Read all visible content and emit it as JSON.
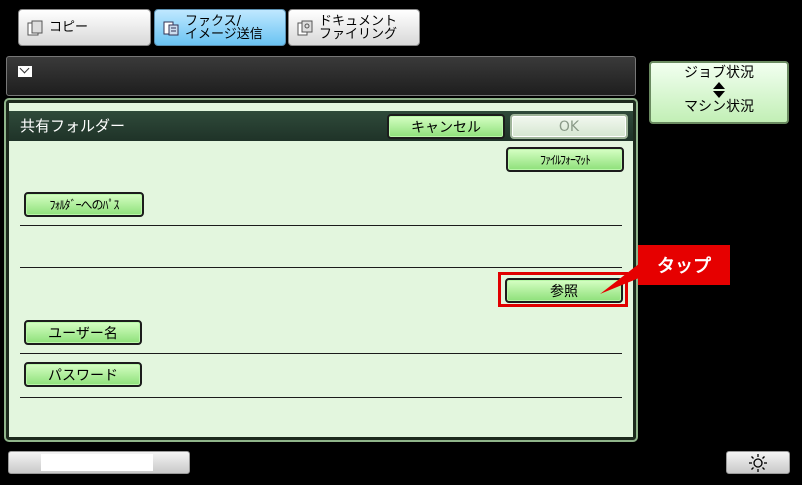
{
  "tabs": [
    {
      "label": "コピー",
      "icon": "copy-icon",
      "active": false
    },
    {
      "label": "ファクス/\nイメージ送信",
      "icon": "fax-icon",
      "active": true
    },
    {
      "label": "ドキュメント\nファイリング",
      "icon": "document-filing-icon",
      "active": false
    }
  ],
  "message_bar": {
    "icon": "envelope-icon"
  },
  "job_status": {
    "line1": "ジョブ状況",
    "line2": "マシン状況",
    "icon": "up-down-arrows-icon"
  },
  "panel": {
    "title": "共有フォルダー",
    "cancel_label": "キャンセル",
    "ok_label": "OK",
    "file_format_label": "ﾌｧｲﾙﾌｫｰﾏｯﾄ",
    "folder_path_label": "ﾌｫﾙﾀﾞｰへのﾊﾟｽ",
    "browse_label": "参照",
    "username_label": "ユーザー名",
    "password_label": "パスワード"
  },
  "annotation": {
    "callout": "タップ"
  },
  "bottom": {
    "settings_icon": "brightness-icon"
  },
  "colors": {
    "panel_bg": "#e3f6de",
    "button_green": "#8ee07a",
    "header_dark": "#2f4a3a",
    "highlight_red": "#e00000"
  }
}
